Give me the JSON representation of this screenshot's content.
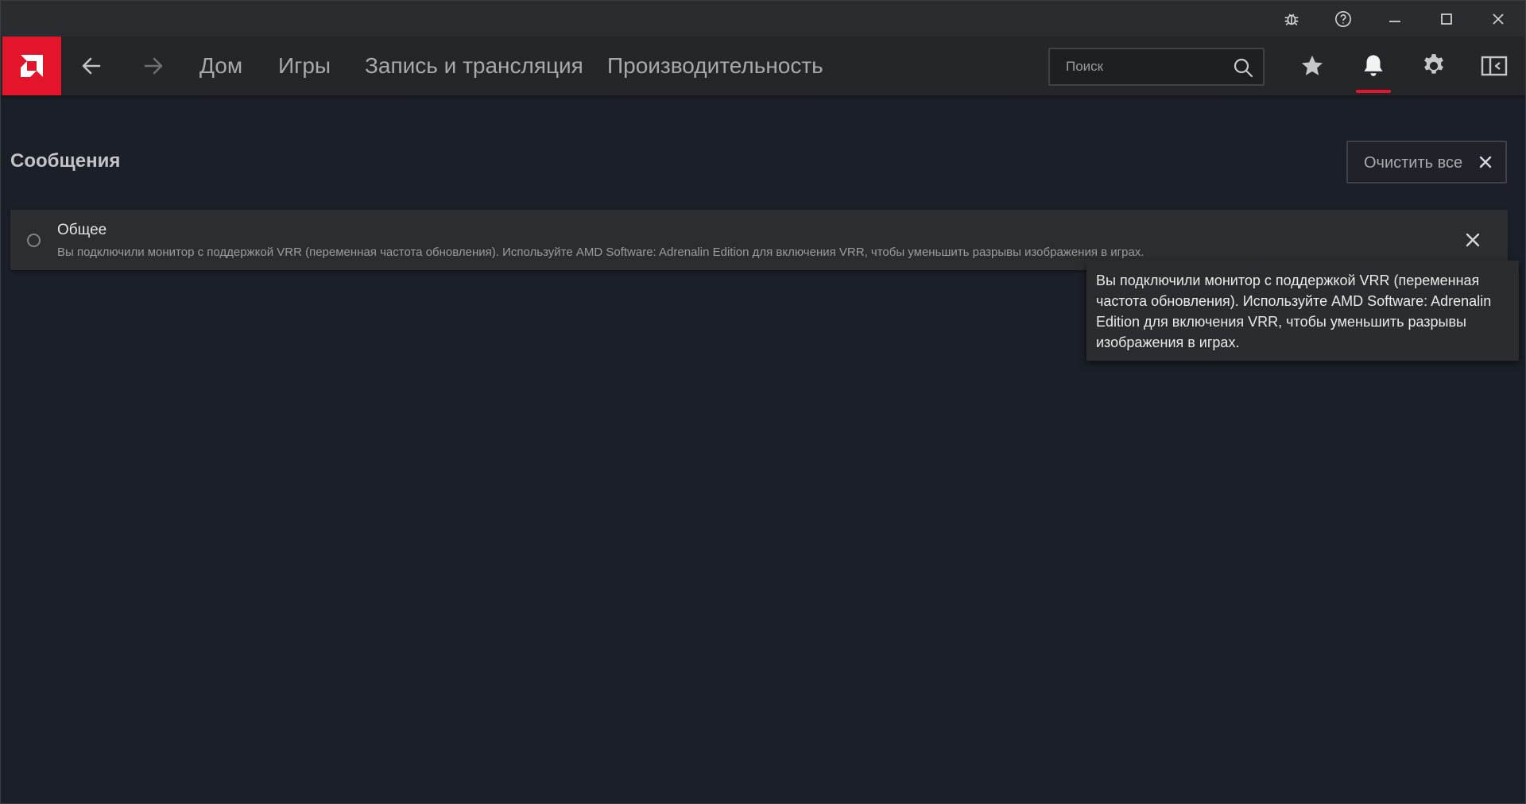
{
  "titlebar": {
    "buttons": [
      {
        "name": "bug-report",
        "icon": "bug-icon"
      },
      {
        "name": "help",
        "icon": "help-circle-icon"
      },
      {
        "name": "minimize",
        "icon": "minimize-icon"
      },
      {
        "name": "maximize",
        "icon": "maximize-icon"
      },
      {
        "name": "close",
        "icon": "close-icon"
      }
    ]
  },
  "nav": {
    "logo_icon": "amd-logo-icon",
    "back_icon": "arrow-left-icon",
    "forward_icon": "arrow-right-icon",
    "links": [
      {
        "label": "Дом"
      },
      {
        "label": "Игры"
      },
      {
        "label": "Запись и трансляция"
      },
      {
        "label": "Производительность"
      }
    ],
    "search": {
      "placeholder": "Поиск",
      "value": ""
    },
    "icons": [
      "star-icon",
      "bell-icon",
      "gear-icon",
      "sidebar-panel-icon"
    ],
    "active_icon": "bell-icon"
  },
  "main": {
    "title": "Сообщения",
    "clear_all_label": "Очистить все",
    "notifications": [
      {
        "title": "Общее",
        "body": "Вы подключили монитор с поддержкой VRR (переменная частота обновления). Используйте AMD Software: Adrenalin Edition для включения VRR, чтобы уменьшить разрывы изображения в играх."
      }
    ]
  },
  "tooltip": {
    "text": "Вы подключили монитор с поддержкой VRR (переменная частота обновления). Используйте AMD Software: Adrenalin Edition для включения VRR, чтобы уменьшить разрывы изображения в играх."
  },
  "colors": {
    "accent": "#e4142b",
    "background": "#1b1f27",
    "navbar": "#252629",
    "card": "#2c2d30"
  }
}
